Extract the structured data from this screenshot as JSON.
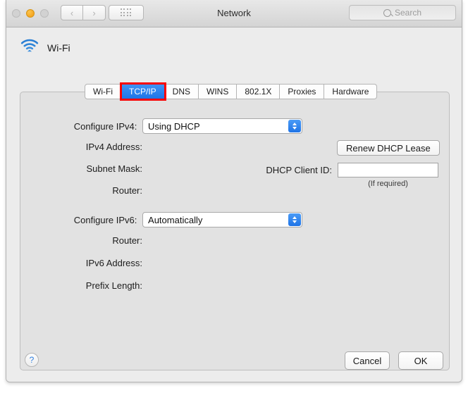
{
  "window": {
    "title": "Network",
    "traffic_lights": [
      "close",
      "minimize",
      "zoom"
    ],
    "nav": {
      "back": "‹",
      "forward": "›"
    },
    "grid_button": "all-preferences",
    "search": {
      "placeholder": "Search",
      "value": ""
    }
  },
  "interface": {
    "icon": "wifi-icon",
    "name": "Wi-Fi"
  },
  "tabs": [
    {
      "label": "Wi-Fi",
      "selected": false
    },
    {
      "label": "TCP/IP",
      "selected": true,
      "annotated": true
    },
    {
      "label": "DNS",
      "selected": false
    },
    {
      "label": "WINS",
      "selected": false
    },
    {
      "label": "802.1X",
      "selected": false
    },
    {
      "label": "Proxies",
      "selected": false
    },
    {
      "label": "Hardware",
      "selected": false
    }
  ],
  "form": {
    "configure_ipv4": {
      "label": "Configure IPv4:",
      "value": "Using DHCP"
    },
    "ipv4_address": {
      "label": "IPv4 Address:",
      "value": ""
    },
    "subnet_mask": {
      "label": "Subnet Mask:",
      "value": ""
    },
    "router_v4": {
      "label": "Router:",
      "value": ""
    },
    "renew_lease_button": "Renew DHCP Lease",
    "dhcp_client_id": {
      "label": "DHCP Client ID:",
      "value": "",
      "placeholder": "",
      "hint": "(If required)"
    },
    "configure_ipv6": {
      "label": "Configure IPv6:",
      "value": "Automatically"
    },
    "router_v6": {
      "label": "Router:",
      "value": ""
    },
    "ipv6_address": {
      "label": "IPv6 Address:",
      "value": ""
    },
    "prefix_length": {
      "label": "Prefix Length:",
      "value": ""
    }
  },
  "footer": {
    "help": "?",
    "cancel": "Cancel",
    "ok": "OK"
  },
  "colors": {
    "accent_blue": "#1f75e8",
    "annotation_red": "#f80000",
    "window_bg": "#ececec",
    "panel_bg": "#e2e2e2"
  }
}
